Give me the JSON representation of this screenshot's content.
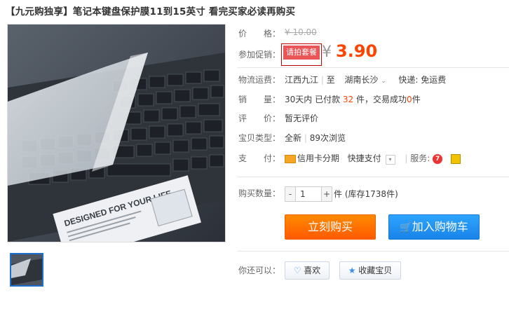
{
  "product": {
    "title": "【九元购独享】笔记本键盘保护膜11到15英寸 看完买家必读再购买"
  },
  "price": {
    "label": "价　　格：",
    "original": "¥ 10.00"
  },
  "promo": {
    "label": "参加促销：",
    "tag": "请拍套餐",
    "currency": "¥",
    "price": "3.90"
  },
  "shipping": {
    "label": "物流运费：",
    "from": "江西九江",
    "sep": "至",
    "to": "湖南长沙",
    "method": "快递: 免运费"
  },
  "sales": {
    "label": "销　　量：",
    "prefix": "30天内 已付款",
    "count": "32",
    "mid": "件，交易成功",
    "success": "0",
    "suffix": "件"
  },
  "review": {
    "label": "评　　价：",
    "value": "暂无评价"
  },
  "item_type": {
    "label": "宝贝类型：",
    "condition": "全新",
    "views": "89次浏览"
  },
  "payment": {
    "label": "支　　付：",
    "credit": "信用卡分期",
    "express": "快捷支付",
    "service_label": "服务:"
  },
  "quantity": {
    "label": "购买数量：",
    "minus": "-",
    "value": "1",
    "plus": "+",
    "unit": "件",
    "stock": "(库存1738件)"
  },
  "actions": {
    "buy_now": "立刻购买",
    "add_cart": "加入购物车"
  },
  "social": {
    "label": "你还可以：",
    "like": "喜欢",
    "favorite": "收藏宝贝"
  },
  "image_text": {
    "sticker_heading": "DESIGNED FOR YOUR LIFE"
  },
  "colors": {
    "accent_orange": "#ff4400",
    "buy_button": "#ff6600",
    "cart_button": "#1e90f0",
    "promo_border": "#c40000"
  }
}
